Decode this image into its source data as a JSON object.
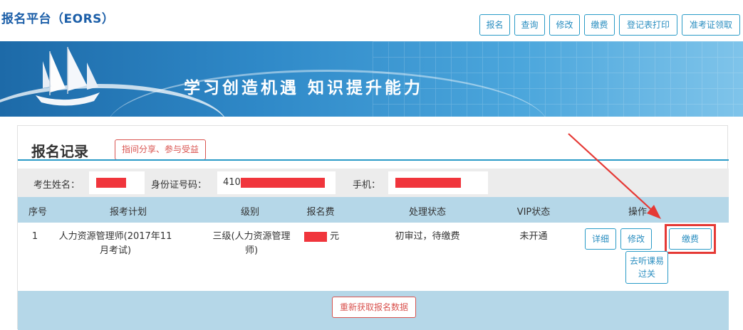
{
  "app": {
    "title": "报名平台（EORS）"
  },
  "topnav": [
    {
      "label": "报名"
    },
    {
      "label": "查询"
    },
    {
      "label": "修改"
    },
    {
      "label": "缴费"
    },
    {
      "label": "登记表打印"
    },
    {
      "label": "准考证领取"
    }
  ],
  "banner": {
    "slogan": "学习创造机遇  知识提升能力"
  },
  "panel": {
    "title": "报名记录",
    "invite_label": "指间分享、参与受益",
    "refresh_label": "重新获取报名数据"
  },
  "candidate": {
    "name_label": "考生姓名：",
    "id_label": "身份证号码：",
    "id_value_prefix": "410",
    "phone_label": "手机："
  },
  "table": {
    "headers": [
      "序号",
      "报考计划",
      "级别",
      "报名费",
      "处理状态",
      "VIP状态",
      "操作"
    ],
    "rows": [
      {
        "index": "1",
        "plan": "人力资源管理师(2017年11月考试)",
        "level": "三级(人力资源管理师)",
        "fee_unit": "元",
        "status": "初审过，待缴费",
        "vip": "未开通",
        "actions": {
          "detail": "详细",
          "edit": "修改",
          "pay": "缴费",
          "course": "去听课易过关"
        }
      }
    ]
  },
  "colors": {
    "primary_blue": "#2a9bc7",
    "header_bg": "#b5d7e8",
    "danger_red": "#d9534f",
    "redaction": "#f0353c",
    "annotation_red": "#e53935"
  }
}
